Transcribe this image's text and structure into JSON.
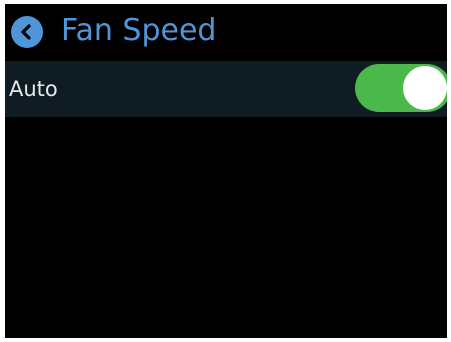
{
  "header": {
    "title": "Fan Speed",
    "back_icon": "chevron-left-icon",
    "accent_color": "#4f95d8"
  },
  "settings": [
    {
      "label": "Auto",
      "toggle_on": true,
      "toggle_color": "#4bb84b"
    }
  ],
  "colors": {
    "background": "#000000",
    "row_background": "#0f1c24",
    "text": "#e8e8e8"
  }
}
